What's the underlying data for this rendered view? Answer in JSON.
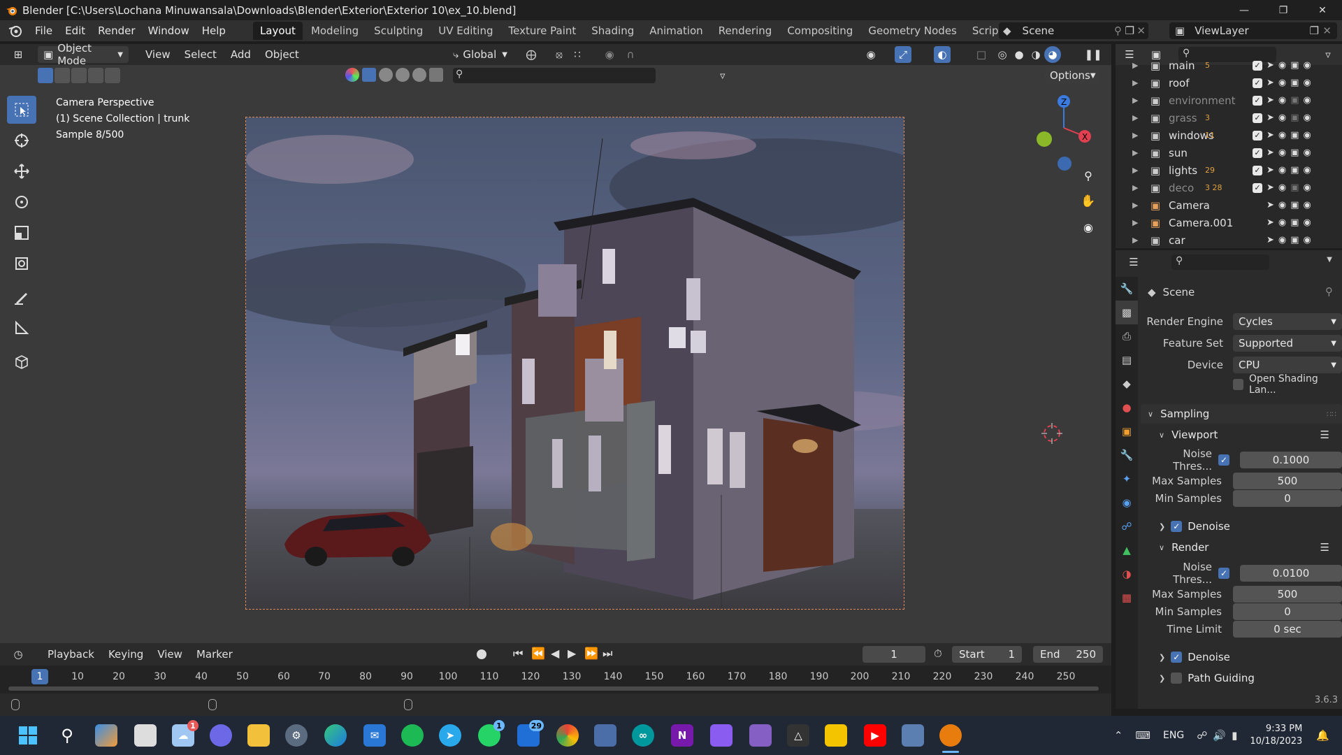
{
  "window": {
    "title": "Blender [C:\\Users\\Lochana Minuwansala\\Downloads\\Blender\\Exterior\\Exterior 10\\ex_10.blend]"
  },
  "menus": [
    "File",
    "Edit",
    "Render",
    "Window",
    "Help"
  ],
  "workspaces": [
    "Layout",
    "Modeling",
    "Sculpting",
    "UV Editing",
    "Texture Paint",
    "Shading",
    "Animation",
    "Rendering",
    "Compositing",
    "Geometry Nodes",
    "Scripting"
  ],
  "active_workspace": "Layout",
  "scene_name": "Scene",
  "view_layer": "ViewLayer",
  "viewport_header": {
    "mode": "Object Mode",
    "menus": [
      "View",
      "Select",
      "Add",
      "Object"
    ],
    "orientation": "Global",
    "options_label": "Options"
  },
  "viewport_info": {
    "line1": "Camera Perspective",
    "line2": "(1) Scene Collection | trunk",
    "line3": "Sample 8/500"
  },
  "outliner": {
    "rows": [
      {
        "name": "main",
        "badge": "5",
        "dim": false
      },
      {
        "name": "roof",
        "badge": "",
        "dim": false
      },
      {
        "name": "environment",
        "badge": "",
        "dim": true
      },
      {
        "name": "grass",
        "badge": "3",
        "dim": true
      },
      {
        "name": "windows",
        "badge": "11",
        "dim": false
      },
      {
        "name": "sun",
        "badge": "",
        "dim": false
      },
      {
        "name": "lights",
        "badge": "29",
        "dim": false
      },
      {
        "name": "deco",
        "badge": "3  28",
        "dim": true
      },
      {
        "name": "Camera",
        "badge": "",
        "dim": false
      },
      {
        "name": "Camera.001",
        "badge": "",
        "dim": false
      },
      {
        "name": "car",
        "badge": "",
        "dim": false
      }
    ]
  },
  "properties": {
    "context": "Scene",
    "render_engine_label": "Render Engine",
    "render_engine": "Cycles",
    "feature_set_label": "Feature Set",
    "feature_set": "Supported",
    "device_label": "Device",
    "device": "CPU",
    "osl_label": "Open Shading Lan...",
    "sampling": "Sampling",
    "viewport": "Viewport",
    "render": "Render",
    "noise_label": "Noise Thres...",
    "viewport_noise": "0.1000",
    "max_samples_label": "Max Samples",
    "viewport_max_samples": "500",
    "min_samples_label": "Min Samples",
    "viewport_min_samples": "0",
    "denoise_label": "Denoise",
    "render_noise": "0.0100",
    "render_max_samples": "500",
    "render_min_samples": "0",
    "time_limit_label": "Time Limit",
    "time_limit": "0 sec",
    "path_guiding_label": "Path Guiding"
  },
  "timeline": {
    "menus": [
      "Playback",
      "Keying",
      "View",
      "Marker"
    ],
    "current_frame": "1",
    "start_label": "Start",
    "start": "1",
    "end_label": "End",
    "end": "250",
    "ruler": [
      "1",
      "10",
      "20",
      "30",
      "40",
      "50",
      "60",
      "70",
      "80",
      "90",
      "100",
      "110",
      "120",
      "130",
      "140",
      "150",
      "160",
      "170",
      "180",
      "190",
      "200",
      "210",
      "220",
      "230",
      "240",
      "250"
    ]
  },
  "version": "3.6.3",
  "taskbar": {
    "lang": "ENG",
    "time": "9:33 PM",
    "date": "10/18/2023",
    "weather_badge": "1",
    "whatsapp_badge": "1",
    "mail_badge": "29"
  },
  "colors": {
    "accent": "#4772b3",
    "background": "#1d1d1d",
    "panel": "#2b2b2b"
  }
}
